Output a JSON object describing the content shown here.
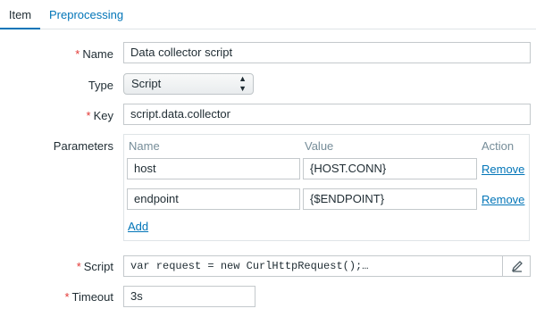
{
  "tabs": [
    {
      "label": "Item",
      "active": true
    },
    {
      "label": "Preprocessing",
      "active": false
    }
  ],
  "form": {
    "name": {
      "label": "Name",
      "required": true,
      "value": "Data collector script"
    },
    "type": {
      "label": "Type",
      "value": "Script"
    },
    "key": {
      "label": "Key",
      "required": true,
      "value": "script.data.collector"
    },
    "parameters": {
      "label": "Parameters",
      "columns": [
        "Name",
        "Value",
        "Action"
      ],
      "rows": [
        {
          "name": "host",
          "value": "{HOST.CONN}",
          "action": "Remove"
        },
        {
          "name": "endpoint",
          "value": "{$ENDPOINT}",
          "action": "Remove"
        }
      ],
      "add_label": "Add"
    },
    "script": {
      "label": "Script",
      "required": true,
      "value": "var request = new CurlHttpRequest();…"
    },
    "timeout": {
      "label": "Timeout",
      "required": true,
      "value": "3s"
    }
  },
  "colors": {
    "accent": "#0275b8",
    "required": "#e33734",
    "border": "#c4c9cc"
  },
  "icons": {
    "select_arrows": "up-down-arrows-icon",
    "edit": "pencil-icon"
  }
}
